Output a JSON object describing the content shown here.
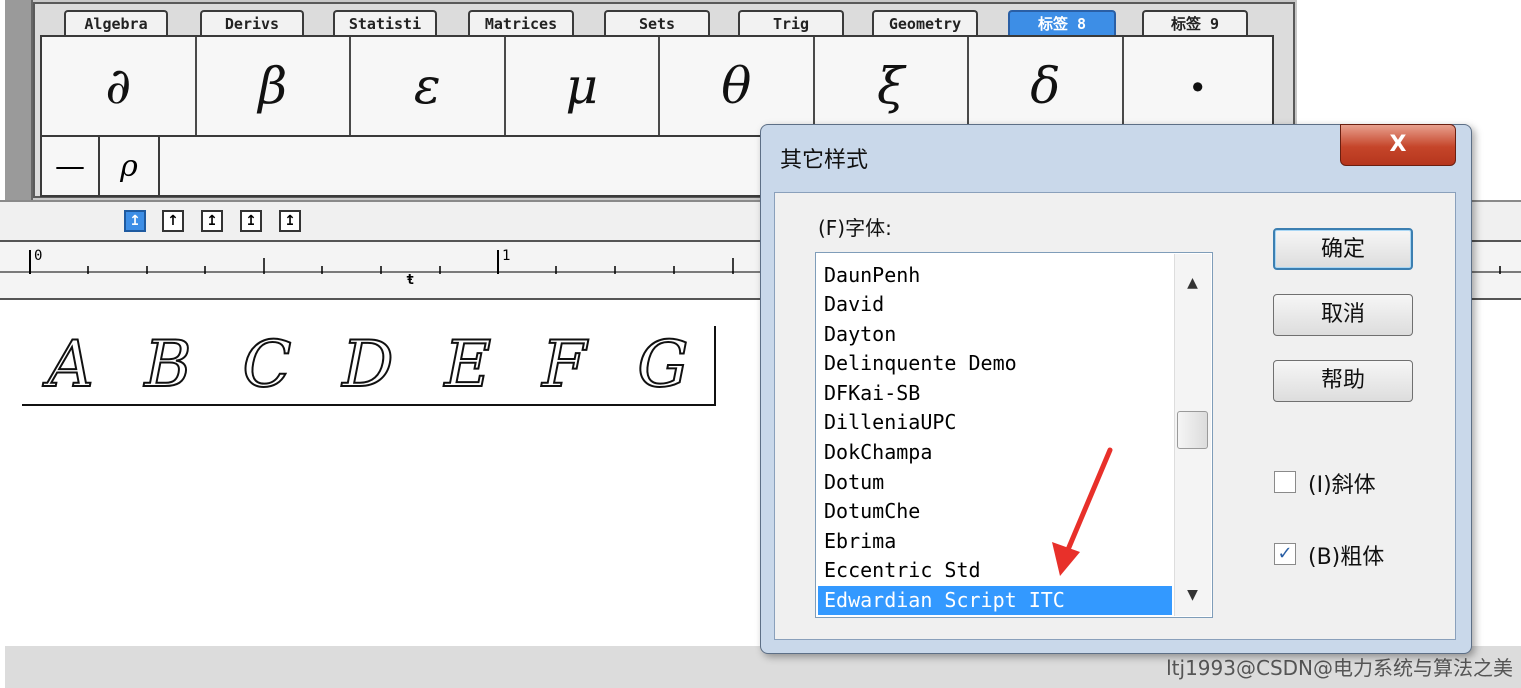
{
  "tabs": [
    "Algebra",
    "Derivs",
    "Statisti",
    "Matrices",
    "Sets",
    "Trig",
    "Geometry",
    "标签 8",
    "标签 9"
  ],
  "active_tab": "标签 8",
  "symbols": [
    "∂",
    "β",
    "ε",
    "μ",
    "θ",
    "ξ",
    "δ",
    "·"
  ],
  "row2_symbols": [
    "—",
    "ρ"
  ],
  "align_buttons": [
    "↥",
    "↑",
    "↥",
    "↥",
    "↥"
  ],
  "ruler": {
    "mark0": "0",
    "mark1": "1",
    "tab_marker": "ŧ"
  },
  "formula_text": [
    "A",
    "B",
    "C",
    "D",
    "E",
    "F",
    "G"
  ],
  "dialog": {
    "title": "其它样式",
    "close_label": "X",
    "font_label": "(F)字体:",
    "fonts": [
      "DaunPenh",
      "David",
      "Dayton",
      "Delinquente Demo",
      "DFKai-SB",
      "DilleniaUPC",
      "DokChampa",
      "Dotum",
      "DotumChe",
      "Ebrima",
      "Eccentric Std",
      "Edwardian Script ITC"
    ],
    "selected_font": "Edwardian Script ITC",
    "ok_label": "确定",
    "cancel_label": "取消",
    "help_label": "帮助",
    "italic_label": "(I)斜体",
    "italic_checked": false,
    "bold_label": "(B)粗体",
    "bold_checked": true
  },
  "watermark": "ltj1993@CSDN@电力系统与算法之美",
  "colors": {
    "accent_blue": "#3399ff",
    "close_red": "#c5452a",
    "arrow_red": "#e8302a"
  }
}
